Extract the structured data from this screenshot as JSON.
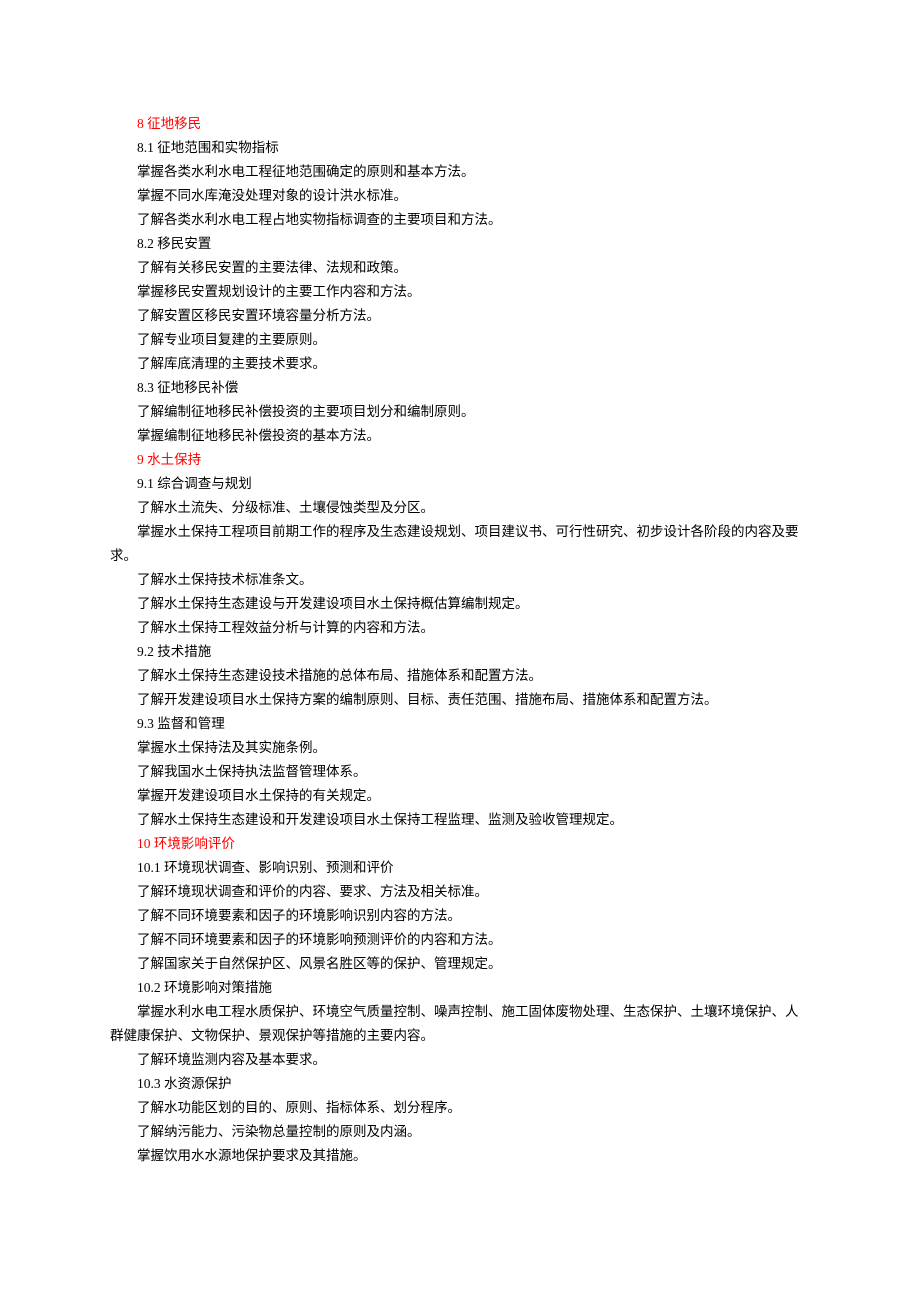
{
  "lines": [
    {
      "text": "8  征地移民",
      "heading": true
    },
    {
      "text": "8.1  征地范围和实物指标"
    },
    {
      "text": "掌握各类水利水电工程征地范围确定的原则和基本方法。"
    },
    {
      "text": "掌握不同水库淹没处理对象的设计洪水标准。"
    },
    {
      "text": "了解各类水利水电工程占地实物指标调查的主要项目和方法。"
    },
    {
      "text": "8.2  移民安置"
    },
    {
      "text": "了解有关移民安置的主要法律、法规和政策。"
    },
    {
      "text": "掌握移民安置规划设计的主要工作内容和方法。"
    },
    {
      "text": "了解安置区移民安置环境容量分析方法。"
    },
    {
      "text": "了解专业项目复建的主要原则。"
    },
    {
      "text": "了解库底清理的主要技术要求。"
    },
    {
      "text": "8.3 征地移民补偿"
    },
    {
      "text": "了解编制征地移民补偿投资的主要项目划分和编制原则。"
    },
    {
      "text": "掌握编制征地移民补偿投资的基本方法。"
    },
    {
      "text": "9  水土保持",
      "heading": true
    },
    {
      "text": "9.1  综合调查与规划"
    },
    {
      "text": "了解水土流失、分级标准、土壤侵蚀类型及分区。"
    },
    {
      "text": "掌握水土保持工程项目前期工作的程序及生态建设规划、项目建议书、可行性研究、初步设计各阶段的内容及要求。"
    },
    {
      "text": "了解水土保持技术标准条文。"
    },
    {
      "text": "了解水土保持生态建设与开发建设项目水土保持概估算编制规定。"
    },
    {
      "text": "了解水土保持工程效益分析与计算的内容和方法。"
    },
    {
      "text": "9.2  技术措施"
    },
    {
      "text": "了解水土保持生态建设技术措施的总体布局、措施体系和配置方法。"
    },
    {
      "text": "了解开发建设项目水土保持方案的编制原则、目标、责任范围、措施布局、措施体系和配置方法。"
    },
    {
      "text": "9.3  监督和管理"
    },
    {
      "text": "掌握水土保持法及其实施条例。"
    },
    {
      "text": "了解我国水土保持执法监督管理体系。"
    },
    {
      "text": "掌握开发建设项目水土保持的有关规定。"
    },
    {
      "text": "了解水土保持生态建设和开发建设项目水土保持工程监理、监测及验收管理规定。"
    },
    {
      "text": "10  环境影响评价",
      "heading": true
    },
    {
      "text": "10.1  环境现状调查、影响识别、预测和评价"
    },
    {
      "text": "了解环境现状调查和评价的内容、要求、方法及相关标准。"
    },
    {
      "text": "了解不同环境要素和因子的环境影响识别内容的方法。"
    },
    {
      "text": "了解不同环境要素和因子的环境影响预测评价的内容和方法。"
    },
    {
      "text": "了解国家关于自然保护区、风景名胜区等的保护、管理规定。"
    },
    {
      "text": "10.2 环境影响对策措施"
    },
    {
      "text": "掌握水利水电工程水质保护、环境空气质量控制、噪声控制、施工固体废物处理、生态保护、土壤环境保护、人群健康保护、文物保护、景观保护等措施的主要内容。"
    },
    {
      "text": "了解环境监测内容及基本要求。"
    },
    {
      "text": "10.3 水资源保护"
    },
    {
      "text": "了解水功能区划的目的、原则、指标体系、划分程序。"
    },
    {
      "text": "了解纳污能力、污染物总量控制的原则及内涵。"
    },
    {
      "text": "掌握饮用水水源地保护要求及其措施。"
    }
  ]
}
